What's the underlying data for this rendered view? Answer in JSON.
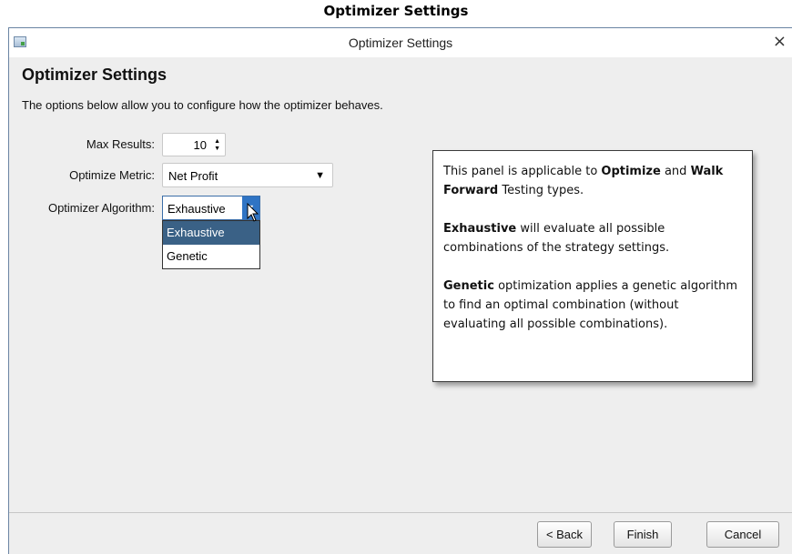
{
  "doc_caption": "Optimizer Settings",
  "window": {
    "title": "Optimizer Settings",
    "close_glyph": "×",
    "icon": "app-icon"
  },
  "page": {
    "title": "Optimizer Settings",
    "description": "The options below allow you to configure how the optimizer behaves."
  },
  "form": {
    "max_results": {
      "label": "Max Results:",
      "value": "10",
      "up": "▲",
      "down": "▼"
    },
    "optimize_metric": {
      "label": "Optimize Metric:",
      "value": "Net Profit",
      "arrow": "▼"
    },
    "optimizer_algorithm": {
      "label": "Optimizer Algorithm:",
      "value": "Exhaustive",
      "arrow": "▼",
      "options": [
        "Exhaustive",
        "Genetic"
      ],
      "selected_index": 0
    }
  },
  "info_panel": {
    "p1": {
      "a": "This panel is applicable to ",
      "b": "Optimize",
      "c": " and ",
      "d": "Walk Forward",
      "e": " Testing types."
    },
    "p2": {
      "a": "Exhaustive",
      "b": " will evaluate all possible combinations of the strategy settings."
    },
    "p3": {
      "a": "Genetic",
      "b": " optimization applies a genetic algorithm to find an optimal combination (without evaluating all possible combinations)."
    }
  },
  "footer": {
    "back_label": "< Back",
    "finish_label": "Finish",
    "cancel_label": "Cancel"
  },
  "colors": {
    "accent": "#2f74c4",
    "selected_item": "#3a6186",
    "window_bg": "#eeeeee"
  }
}
